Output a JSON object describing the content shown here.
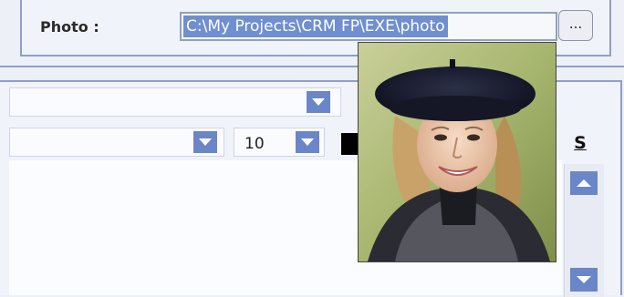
{
  "photo_section": {
    "label": "Photo :",
    "path_value": "C:\\My Projects\\CRM FP\\EXE\\photo",
    "browse_label": "..."
  },
  "formatting": {
    "font_size": "10",
    "underline_label": "S"
  },
  "colors": {
    "accent": "#6b86c8",
    "selection": "#6f8fd0",
    "border": "#8f9fc8",
    "panel": "#f1f3fa",
    "text_color_swatch": "#000000"
  },
  "icons": {
    "dropdown": "chevron-down-icon",
    "scroll_up": "arrow-up-icon",
    "scroll_down": "arrow-down-icon"
  }
}
